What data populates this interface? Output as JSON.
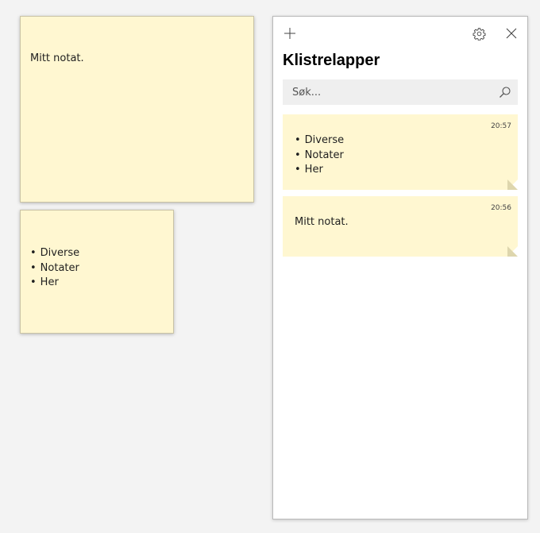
{
  "desktop_notes": [
    {
      "text": "Mitt notat."
    },
    {
      "bullets": [
        "Diverse",
        "Notater",
        "Her"
      ]
    }
  ],
  "panel": {
    "title": "Klistrelapper",
    "search_placeholder": "Søk...",
    "icons": {
      "add": "plus-icon",
      "settings": "gear-icon",
      "close": "close-icon",
      "search": "search-icon"
    },
    "notes": [
      {
        "time": "20:57",
        "bullets": [
          "Diverse",
          "Notater",
          "Her"
        ]
      },
      {
        "time": "20:56",
        "text": "Mitt notat."
      }
    ]
  },
  "colors": {
    "note_yellow": "#fff7d1",
    "panel_background": "#ffffff",
    "search_background": "#efefef",
    "desktop_background": "#f3f3f3"
  }
}
